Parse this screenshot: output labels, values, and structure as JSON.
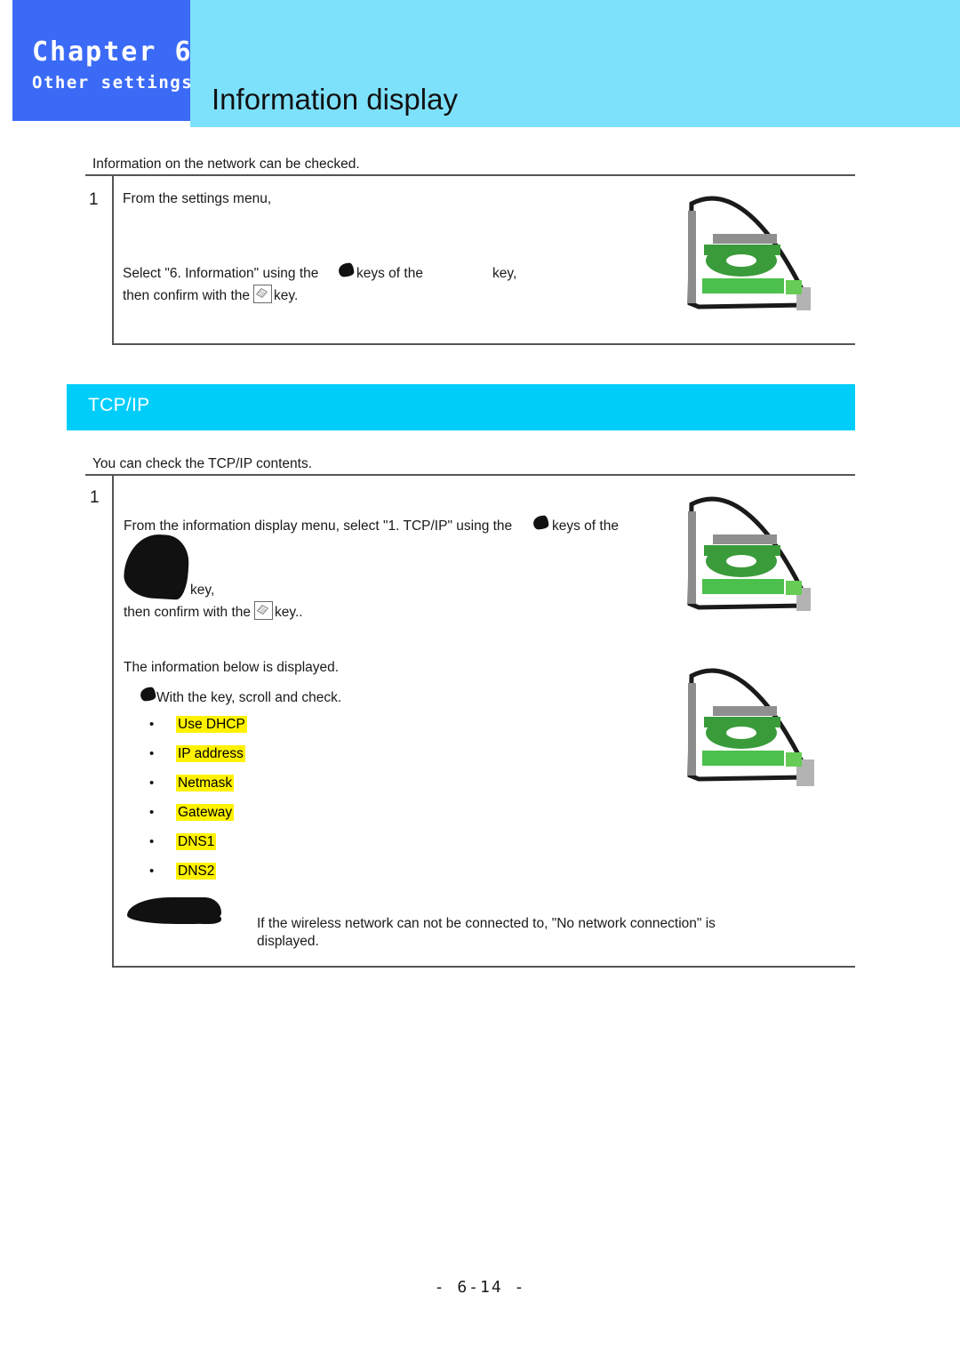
{
  "header": {
    "chapter_label": "Chapter 6",
    "chapter_subtitle": "Other settings",
    "page_title": "Information display",
    "blue_color": "#3B6AF6",
    "cyan_color": "#7EE1FC"
  },
  "intro": {
    "text": "Information on the network can be checked."
  },
  "step1": {
    "number": "1",
    "line1": "From the settings menu,",
    "line2_part1": "Select \"6. Information\" using the",
    "line2_part2": "keys of the",
    "line2_part3": "key,",
    "line3_part1": "then confirm with the",
    "line3_part2": "key."
  },
  "section": {
    "banner_title": "TCP/IP",
    "banner_color": "#00CDFA",
    "intro": "You can check the TCP/IP contents."
  },
  "step2": {
    "number": "1",
    "line1_part1": "From the information display menu, select \"1. TCP/IP\" using the",
    "line1_part2": "keys of the",
    "line2": "key,",
    "line3_part1": "then confirm with the",
    "line3_part2": "key..",
    "line4": "The information below is displayed.",
    "line5": "With the   key, scroll and check.",
    "bullets": [
      "Use DHCP",
      "IP address",
      "Netmask",
      "Gateway",
      "DNS1",
      "DNS2"
    ],
    "highlight_color": "#FFF200",
    "note_line1": "If the wireless network can not be connected to, \"No network connection\" is",
    "note_line2": "displayed."
  },
  "footer": {
    "page_number": "- 6-14 -"
  },
  "icons": {
    "arrow_key": "arrow-key-glyph",
    "enter_key": "enter-key-glyph",
    "device": "device-display-illustration"
  }
}
